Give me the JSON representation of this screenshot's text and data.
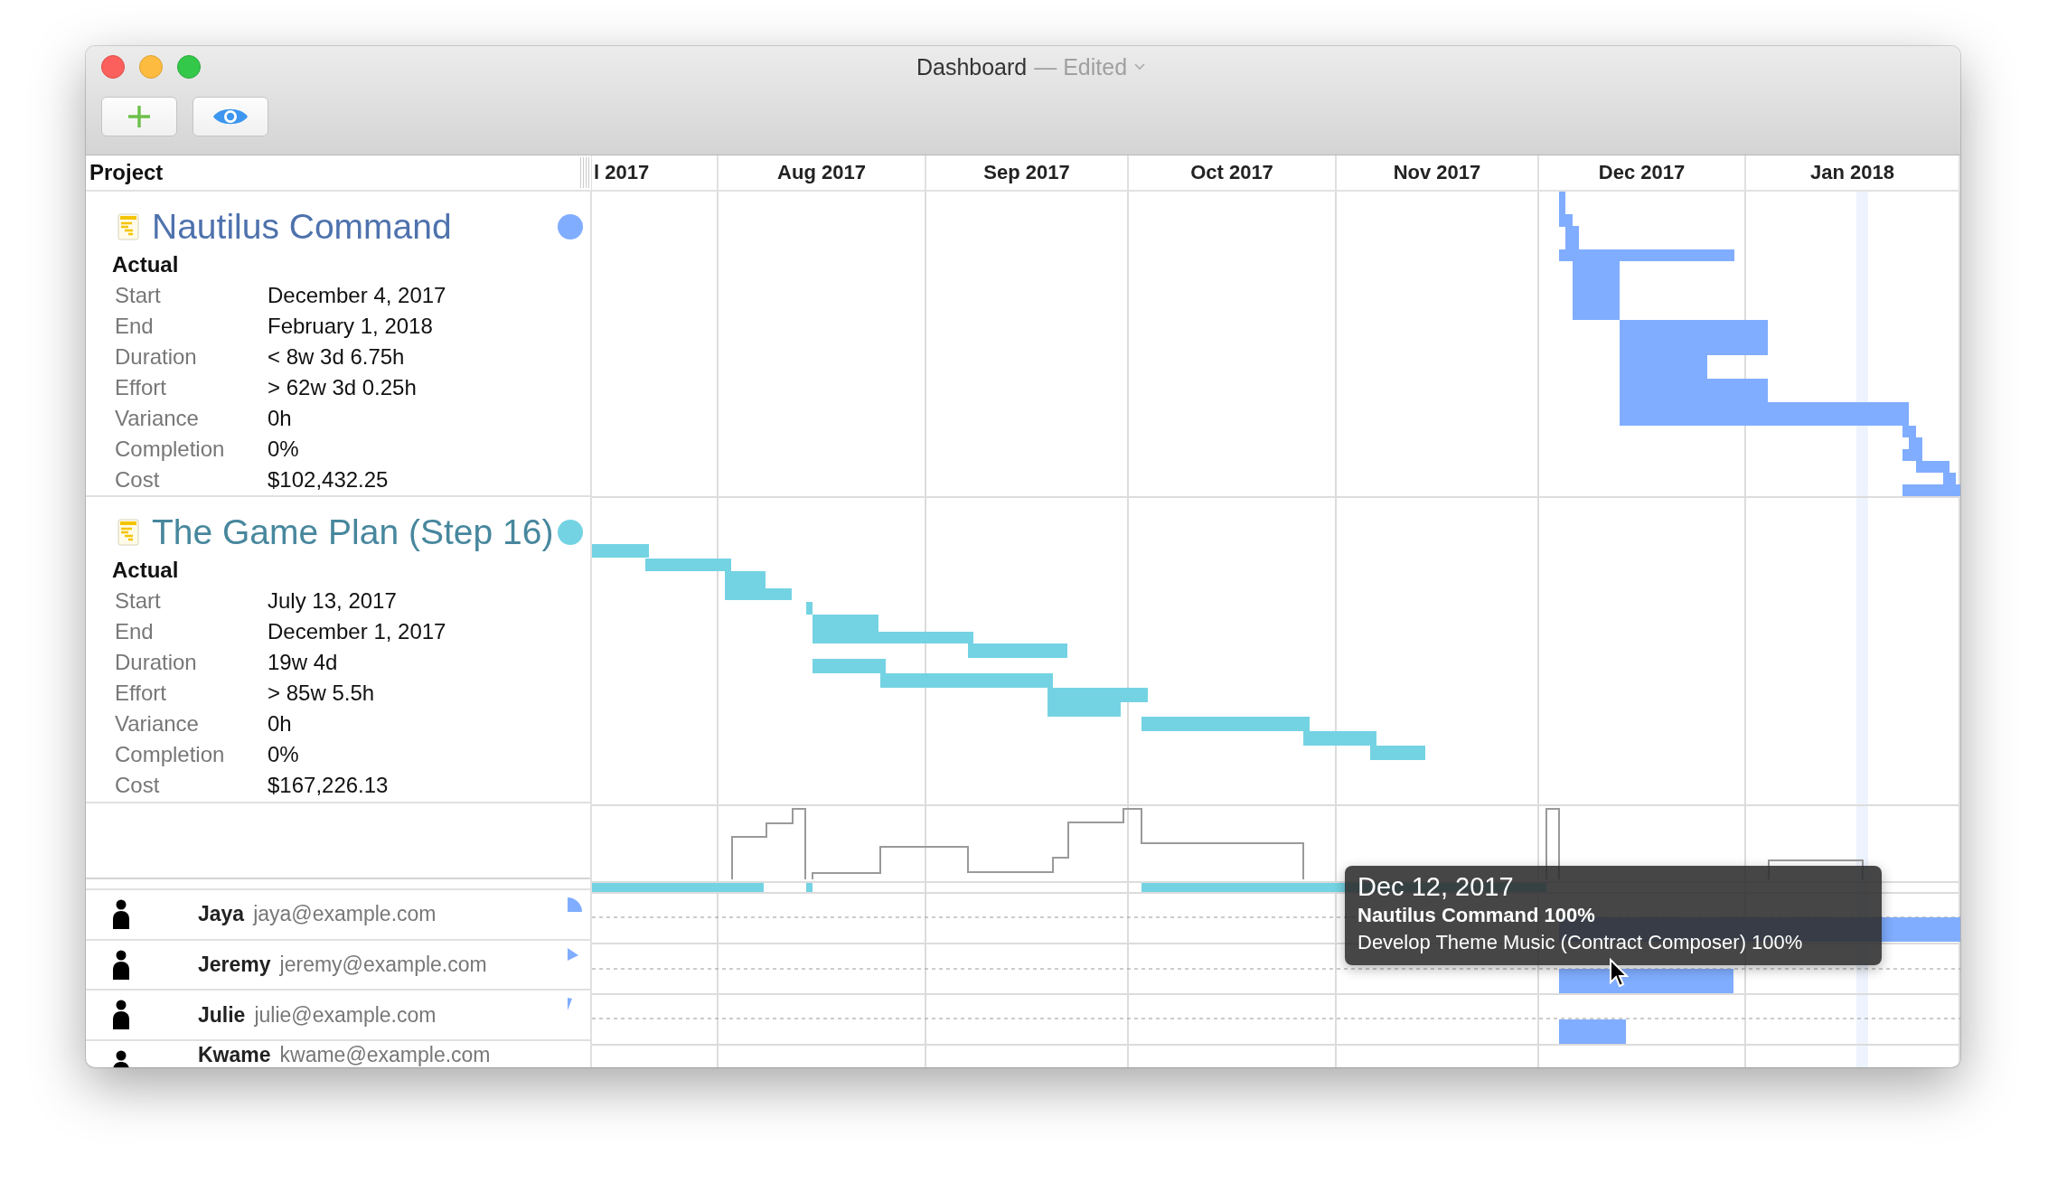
{
  "window": {
    "title": "Dashboard",
    "edited": "— Edited"
  },
  "toolbar": [
    {
      "kind": "add"
    },
    {
      "kind": "view"
    }
  ],
  "timeline": {
    "column_header": "Project",
    "months": [
      "l 2017",
      "Aug 2017",
      "Sep 2017",
      "Oct 2017",
      "Nov 2017",
      "Dec 2017",
      "Jan 2018"
    ]
  },
  "projects": [
    {
      "title": "Nautilus Command",
      "color": "#80adff",
      "section": "Actual",
      "fields": [
        {
          "label": "Start",
          "value": "December 4, 2017"
        },
        {
          "label": "End",
          "value": "February 1, 2018"
        },
        {
          "label": "Duration",
          "value": "< 8w 3d 6.75h"
        },
        {
          "label": "Effort",
          "value": "> 62w 3d 0.25h"
        },
        {
          "label": "Variance",
          "value": "0h"
        },
        {
          "label": "Completion",
          "value": "0%"
        },
        {
          "label": "Cost",
          "value": "$102,432.25"
        }
      ]
    },
    {
      "title": "The Game Plan (Step 16)",
      "color": "#74d3e3",
      "section": "Actual",
      "fields": [
        {
          "label": "Start",
          "value": "July 13, 2017"
        },
        {
          "label": "End",
          "value": "December 1, 2017"
        },
        {
          "label": "Duration",
          "value": "19w 4d"
        },
        {
          "label": "Effort",
          "value": "> 85w 5.5h"
        },
        {
          "label": "Variance",
          "value": "0h"
        },
        {
          "label": "Completion",
          "value": "0%"
        },
        {
          "label": "Cost",
          "value": "$167,226.13"
        }
      ]
    }
  ],
  "resources": [
    {
      "name": "Jaya",
      "email": "jaya@example.com"
    },
    {
      "name": "Jeremy",
      "email": "jeremy@example.com"
    },
    {
      "name": "Julie",
      "email": "julie@example.com"
    },
    {
      "name": "Kwame",
      "email": "kwame@example.com"
    }
  ],
  "tooltip": {
    "date": "Dec 12, 2017",
    "project_line": "Nautilus Command 100%",
    "task_line": "Develop Theme Music (Contract Composer) 100%"
  }
}
